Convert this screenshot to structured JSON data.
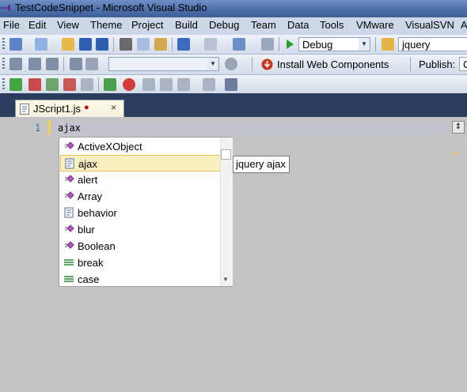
{
  "window": {
    "title": "TestCodeSnippet - Microsoft Visual Studio"
  },
  "menu": [
    "File",
    "Edit",
    "View",
    "Theme",
    "Project",
    "Build",
    "Debug",
    "Team",
    "Data",
    "Tools",
    "VMware",
    "VisualSVN",
    "A"
  ],
  "toolbar": {
    "config": "Debug",
    "search": "jquery",
    "install_web_components": "Install Web Components",
    "publish_label": "Publish:",
    "publish_value": "C"
  },
  "tab": {
    "label": "JScript1.js",
    "modified": "●",
    "close": "×"
  },
  "editor": {
    "line_number": "1",
    "code": "ajax"
  },
  "completion": {
    "items": [
      {
        "label": "ActiveXObject",
        "icon": "method-icon"
      },
      {
        "label": "ajax",
        "icon": "snippet-icon",
        "selected": true
      },
      {
        "label": "alert",
        "icon": "method-icon"
      },
      {
        "label": "Array",
        "icon": "method-icon"
      },
      {
        "label": "behavior",
        "icon": "snippet-icon"
      },
      {
        "label": "blur",
        "icon": "method-icon"
      },
      {
        "label": "Boolean",
        "icon": "method-icon"
      },
      {
        "label": "break",
        "icon": "keyword-icon"
      },
      {
        "label": "case",
        "icon": "keyword-icon"
      }
    ],
    "tooltip": "jquery ajax"
  }
}
